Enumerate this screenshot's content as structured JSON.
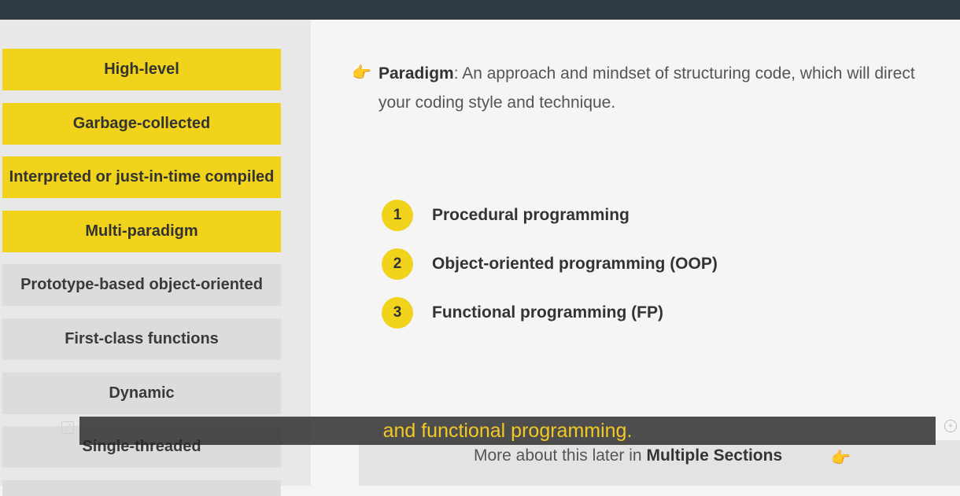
{
  "sidebar": {
    "items": [
      {
        "label": "High-level",
        "highlighted": true
      },
      {
        "label": "Garbage-collected",
        "highlighted": true
      },
      {
        "label": "Interpreted or just-in-time compiled",
        "highlighted": true
      },
      {
        "label": "Multi-paradigm",
        "highlighted": true
      },
      {
        "label": "Prototype-based object-oriented",
        "highlighted": false
      },
      {
        "label": "First-class functions",
        "highlighted": false
      },
      {
        "label": "Dynamic",
        "highlighted": false
      },
      {
        "label": "Single-threaded",
        "highlighted": false
      }
    ]
  },
  "main": {
    "definition_term": "Paradigm",
    "definition_text": ": An approach and mindset of structuring code, which will direct your coding style and technique.",
    "list": [
      {
        "number": "1",
        "label": "Procedural programming"
      },
      {
        "number": "2",
        "label": "Object-oriented programming (OOP)"
      },
      {
        "number": "3",
        "label": "Functional programming (FP)"
      }
    ],
    "more_prefix": "More about this later in ",
    "more_bold": "Multiple Sections"
  },
  "caption": {
    "text": "and functional programming."
  },
  "colors": {
    "accent_yellow": "#f0d31a",
    "caption_yellow": "#f3c924",
    "topbar": "#2f3a42"
  },
  "icons": {
    "pointer": "pointing-hand-icon",
    "expand": "expand-icon",
    "add": "plus-circle-icon"
  }
}
